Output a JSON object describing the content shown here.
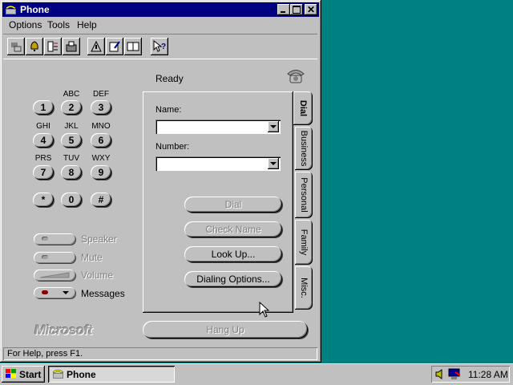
{
  "window": {
    "title": "Phone"
  },
  "menu": [
    {
      "label": "Options"
    },
    {
      "label": "Tools"
    },
    {
      "label": "Help"
    }
  ],
  "toolbar": [
    {
      "icon": "network-icon"
    },
    {
      "icon": "bell-icon"
    },
    {
      "icon": "phone-list-icon"
    },
    {
      "icon": "fax-icon"
    },
    {
      "icon": "sign-icon"
    },
    {
      "icon": "notepad-icon"
    },
    {
      "icon": "book-icon"
    },
    {
      "icon": "help-pointer-icon"
    }
  ],
  "status_text": "Ready",
  "keypad": [
    {
      "key": "1",
      "letters": ""
    },
    {
      "key": "2",
      "letters": "ABC"
    },
    {
      "key": "3",
      "letters": "DEF"
    },
    {
      "key": "4",
      "letters": "GHI"
    },
    {
      "key": "5",
      "letters": "JKL"
    },
    {
      "key": "6",
      "letters": "MNO"
    },
    {
      "key": "7",
      "letters": "PRS"
    },
    {
      "key": "8",
      "letters": "TUV"
    },
    {
      "key": "9",
      "letters": "WXY"
    },
    {
      "key": "*",
      "letters": ""
    },
    {
      "key": "0",
      "letters": ""
    },
    {
      "key": "#",
      "letters": ""
    }
  ],
  "controls": {
    "speaker": "Speaker",
    "mute": "Mute",
    "volume": "Volume",
    "messages": "Messages"
  },
  "brand": "Microsoft",
  "dial_panel": {
    "name_label": "Name:",
    "name_value": "",
    "number_label": "Number:",
    "number_value": "",
    "buttons": {
      "dial": "Dial",
      "check_name": "Check Name",
      "look_up": "Look Up...",
      "dialing_options": "Dialing Options..."
    }
  },
  "tabs": [
    {
      "label": "Dial",
      "active": true
    },
    {
      "label": "Business",
      "active": false
    },
    {
      "label": "Personal",
      "active": false
    },
    {
      "label": "Family",
      "active": false
    },
    {
      "label": "Misc.",
      "active": false
    }
  ],
  "hang_up": "Hang Up",
  "statusbar": "For Help, press F1.",
  "taskbar": {
    "start": "Start",
    "task": "Phone",
    "clock": "11:28 AM"
  },
  "colors": {
    "desktop": "#008080",
    "titlebar": "#000080",
    "face": "#c0c0c0"
  }
}
